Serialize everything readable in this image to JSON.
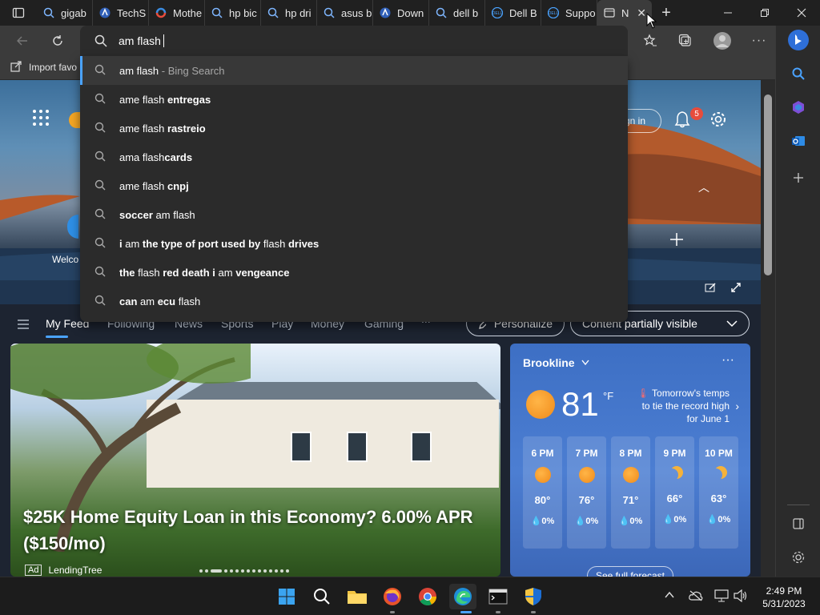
{
  "tabs": [
    {
      "label": "gigab",
      "icon": "search-icon"
    },
    {
      "label": "TechS",
      "icon": "techspot-icon"
    },
    {
      "label": "Mothe",
      "icon": "motherboard-site-icon"
    },
    {
      "label": "hp bic",
      "icon": "search-icon"
    },
    {
      "label": "hp dri",
      "icon": "search-icon"
    },
    {
      "label": "asus b",
      "icon": "search-icon"
    },
    {
      "label": "Down",
      "icon": "asus-icon"
    },
    {
      "label": "dell b",
      "icon": "search-icon"
    },
    {
      "label": "Dell B",
      "icon": "dell-icon"
    },
    {
      "label": "Suppo",
      "icon": "dell-icon"
    },
    {
      "label": "N",
      "icon": "new-tab-icon",
      "active": true
    }
  ],
  "address": {
    "value": "am flash"
  },
  "bookmarks": {
    "import_label": "Import favo"
  },
  "suggestions": [
    {
      "prefix": "am flash",
      "bold": "",
      "suffix": " - Bing Search",
      "type": "bing"
    },
    {
      "prefix": "ame flash ",
      "bold": "entregas",
      "suffix": ""
    },
    {
      "prefix": "ame flash ",
      "bold": "rastreio",
      "suffix": ""
    },
    {
      "prefix": "ama flash",
      "bold": "cards",
      "suffix": ""
    },
    {
      "prefix": "ame flash ",
      "bold": "cnpj",
      "suffix": ""
    },
    {
      "prefix": "",
      "bold": "soccer",
      "suffix": " am flash"
    },
    {
      "prefix": "",
      "bold": "i",
      "suffix": " am ",
      "bold2": "the type of port used by",
      "suffix2": " flash ",
      "bold3": "drives"
    },
    {
      "prefix": "",
      "bold": "the",
      "suffix": " flash ",
      "bold2": "red death i",
      "suffix2": " am ",
      "bold3": "vengeance"
    },
    {
      "prefix": "",
      "bold": "can",
      "suffix": " am ",
      "bold2": "ecu",
      "suffix2": " flash",
      "bold3": ""
    }
  ],
  "page": {
    "welcome_text": "Welco",
    "signin_label": "gn in",
    "notification_count": "5"
  },
  "nav": {
    "items": [
      "My Feed",
      "Following",
      "News",
      "Sports",
      "Play",
      "Money",
      "Gaming",
      "..."
    ],
    "personalize_label": "Personalize",
    "content_label": "Content partially visible"
  },
  "card": {
    "title": "$25K Home Equity Loan in this Economy? 6.00% APR ($150/mo)",
    "ad_label": "Ad",
    "source": "LendingTree"
  },
  "weather": {
    "city": "Brookline",
    "temp": "81",
    "unit": "°F",
    "note": "Tomorrow's temps to tie the record high for June 1",
    "hours": [
      {
        "time": "6 PM",
        "icon": "sun",
        "temp": "80°",
        "rain": "0%"
      },
      {
        "time": "7 PM",
        "icon": "sun",
        "temp": "76°",
        "rain": "0%"
      },
      {
        "time": "8 PM",
        "icon": "sun",
        "temp": "71°",
        "rain": "0%"
      },
      {
        "time": "9 PM",
        "icon": "moon",
        "temp": "66°",
        "rain": "0%"
      },
      {
        "time": "10 PM",
        "icon": "moon",
        "temp": "63°",
        "rain": "0%"
      }
    ],
    "forecast_label": "See full forecast"
  },
  "clock": {
    "time": "2:49 PM",
    "date": "5/31/2023"
  },
  "colors": {
    "accent": "#4aa3ff",
    "weather_bg": "#4c7ed2",
    "badge": "#e74c3c"
  }
}
